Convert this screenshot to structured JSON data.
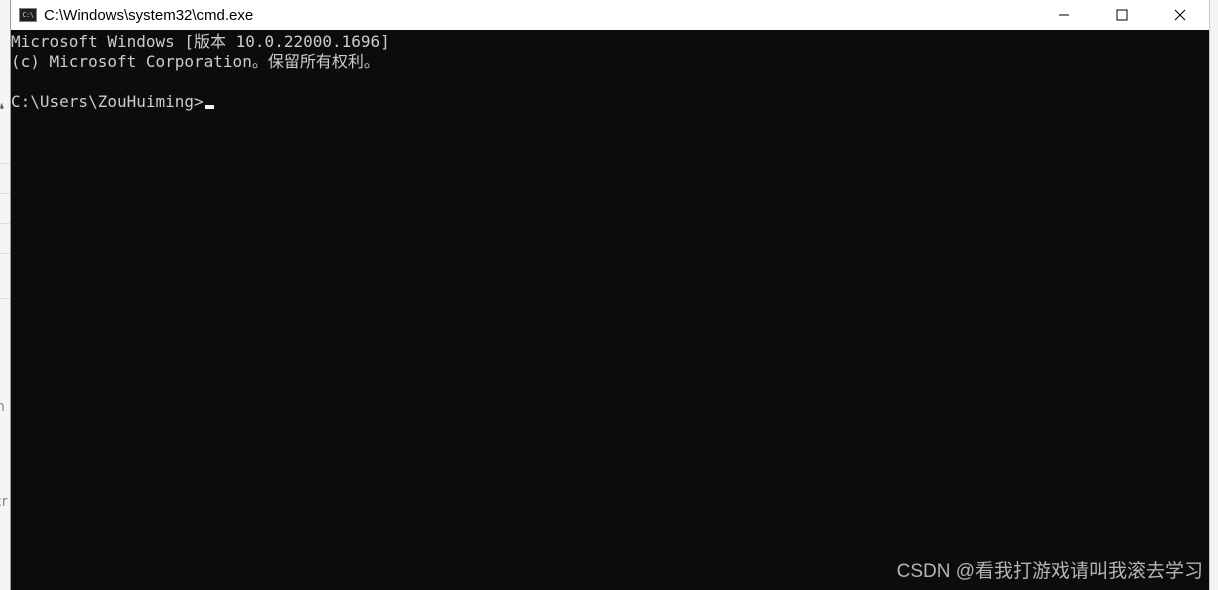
{
  "window": {
    "title": "C:\\Windows\\system32\\cmd.exe",
    "icon": "cmd-console-icon",
    "icon_glyph": "C:\\",
    "controls": [
      "minimize-icon",
      "maximize-icon",
      "close-icon"
    ]
  },
  "console": {
    "lines": [
      "Microsoft Windows [版本 10.0.22000.1696]",
      "(c) Microsoft Corporation。保留所有权利。",
      "",
      "C:\\Users\\ZouHuiming>"
    ]
  },
  "background_app": {
    "fragments": [
      "❛",
      "n",
      "cr"
    ]
  },
  "watermark": "CSDN @看我打游戏请叫我滚去学习",
  "colors": {
    "console_bg": "#0c0c0c",
    "console_text": "#cccccc",
    "titlebar_bg": "#ffffff"
  }
}
